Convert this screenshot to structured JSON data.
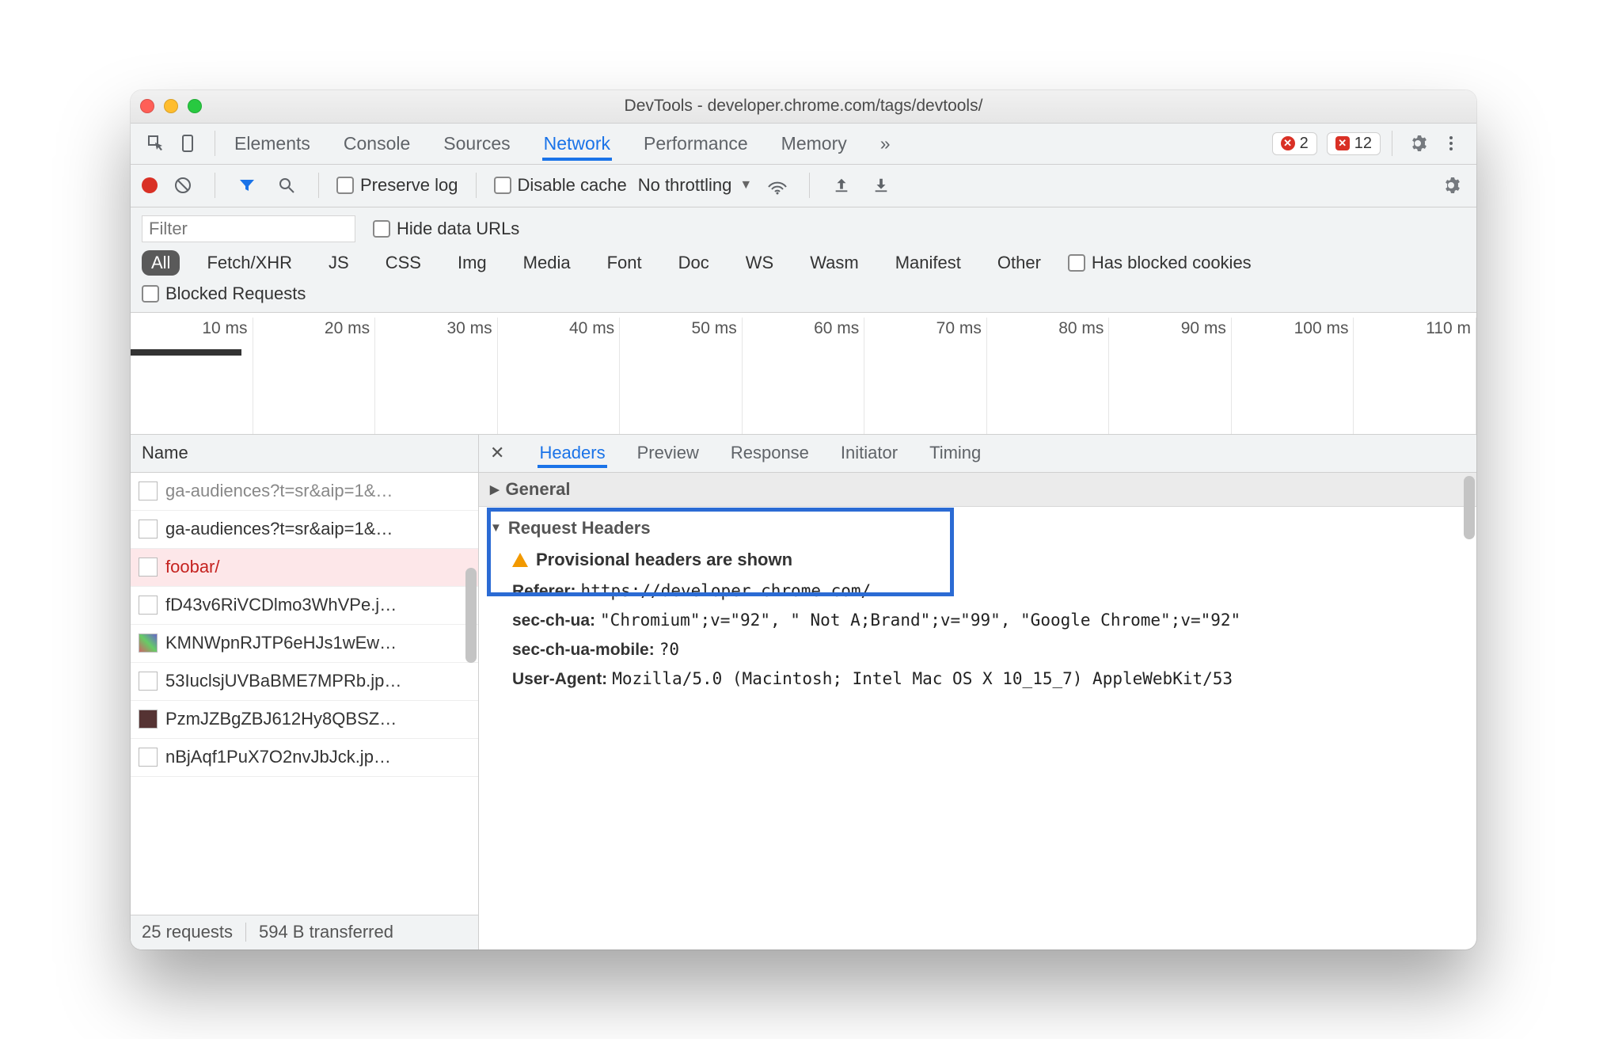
{
  "window": {
    "title": "DevTools - developer.chrome.com/tags/devtools/"
  },
  "tabs": {
    "items": [
      "Elements",
      "Console",
      "Sources",
      "Network",
      "Performance",
      "Memory"
    ],
    "active": "Network",
    "overflow": "»",
    "errors1": "2",
    "errors2": "12"
  },
  "toolbar": {
    "preserve_log": "Preserve log",
    "disable_cache": "Disable cache",
    "throttling": "No throttling"
  },
  "filterbar": {
    "filter_placeholder": "Filter",
    "hide_data_urls": "Hide data URLs",
    "types": [
      "All",
      "Fetch/XHR",
      "JS",
      "CSS",
      "Img",
      "Media",
      "Font",
      "Doc",
      "WS",
      "Wasm",
      "Manifest",
      "Other"
    ],
    "active_type": "All",
    "has_blocked_cookies": "Has blocked cookies",
    "blocked_requests": "Blocked Requests"
  },
  "timeline": {
    "labels": [
      "10 ms",
      "20 ms",
      "30 ms",
      "40 ms",
      "50 ms",
      "60 ms",
      "70 ms",
      "80 ms",
      "90 ms",
      "100 ms",
      "110 m"
    ]
  },
  "list": {
    "header": "Name",
    "rows": [
      {
        "name": "ga-audiences?t=sr&aip=1&…",
        "dim": true
      },
      {
        "name": "ga-audiences?t=sr&aip=1&…"
      },
      {
        "name": "foobar/",
        "selected": true
      },
      {
        "name": "fD43v6RiVCDlmo3WhVPe.j…"
      },
      {
        "name": "KMNWpnRJTP6eHJs1wEw…"
      },
      {
        "name": "53IuclsjUVBaBME7MPRb.jp…"
      },
      {
        "name": "PzmJZBgZBJ612Hy8QBSZ…"
      },
      {
        "name": "nBjAqf1PuX7O2nvJbJck.jp…"
      }
    ],
    "status": {
      "requests": "25 requests",
      "transfer": "594 B transferred"
    }
  },
  "detail": {
    "tabs": [
      "Headers",
      "Preview",
      "Response",
      "Initiator",
      "Timing"
    ],
    "active": "Headers",
    "general_label": "General",
    "req_headers_label": "Request Headers",
    "provisional": "Provisional headers are shown",
    "headers": [
      {
        "k": "Referer:",
        "v": "https://developer.chrome.com/"
      },
      {
        "k": "sec-ch-ua:",
        "v": "\"Chromium\";v=\"92\", \" Not A;Brand\";v=\"99\", \"Google Chrome\";v=\"92\""
      },
      {
        "k": "sec-ch-ua-mobile:",
        "v": "?0"
      },
      {
        "k": "User-Agent:",
        "v": "Mozilla/5.0 (Macintosh; Intel Mac OS X 10_15_7) AppleWebKit/53"
      }
    ]
  }
}
